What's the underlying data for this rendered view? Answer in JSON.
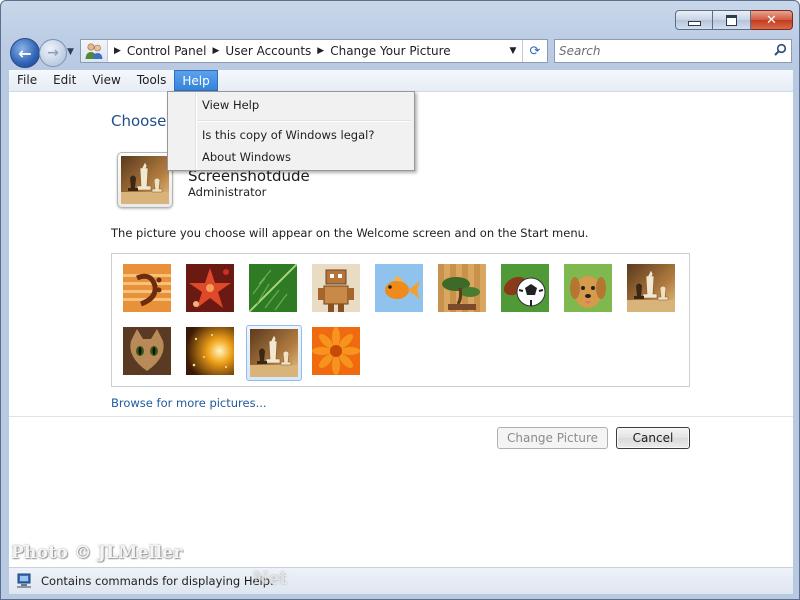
{
  "window": {
    "minimize_icon": "minimize-icon",
    "maximize_icon": "maximize-icon",
    "close_icon": "close-icon",
    "close_glyph": "✕"
  },
  "navigation": {
    "back_glyph": "←",
    "forward_glyph": "→",
    "recent_glyph": "▼"
  },
  "address": {
    "breadcrumbs": [
      "Control Panel",
      "User Accounts",
      "Change Your Picture"
    ],
    "separator": "▶",
    "dropdown_glyph": "▼",
    "refresh_glyph": "⟳"
  },
  "search": {
    "placeholder": "Search",
    "icon_glyph": "⚲"
  },
  "menubar": {
    "items": [
      "File",
      "Edit",
      "View",
      "Tools",
      "Help"
    ],
    "active_index": 4
  },
  "help_menu": {
    "items": [
      "View Help",
      "Is this copy of Windows legal?",
      "About Windows"
    ]
  },
  "page": {
    "title": "Choose",
    "user_name": "Screenshotdude",
    "user_role": "Administrator",
    "description": "The picture you choose will appear on the Welcome screen and on the Start menu.",
    "browse_link": "Browse for more pictures..."
  },
  "pictures": [
    {
      "name": "guitar-picture"
    },
    {
      "name": "starfish-picture"
    },
    {
      "name": "leaf-picture"
    },
    {
      "name": "robot-picture"
    },
    {
      "name": "fish-picture"
    },
    {
      "name": "bonsai-picture"
    },
    {
      "name": "soccer-ball-picture"
    },
    {
      "name": "dog-picture"
    },
    {
      "name": "chess-picture"
    },
    {
      "name": "kitten-picture"
    },
    {
      "name": "sparkle-picture"
    },
    {
      "name": "chess-picture-selected"
    },
    {
      "name": "flower-picture"
    }
  ],
  "selected_picture_index": 11,
  "buttons": {
    "change_picture": "Change Picture",
    "cancel": "Cancel"
  },
  "statusbar": {
    "text": "Contains commands for displaying Help."
  },
  "watermark": {
    "line1": "Photo © JLMeller",
    "line2": "Net"
  },
  "colors": {
    "menu_highlight": "#3a8ae0",
    "link": "#1e5a9c",
    "title": "#1e4e8c",
    "close_button": "#c8452a"
  }
}
